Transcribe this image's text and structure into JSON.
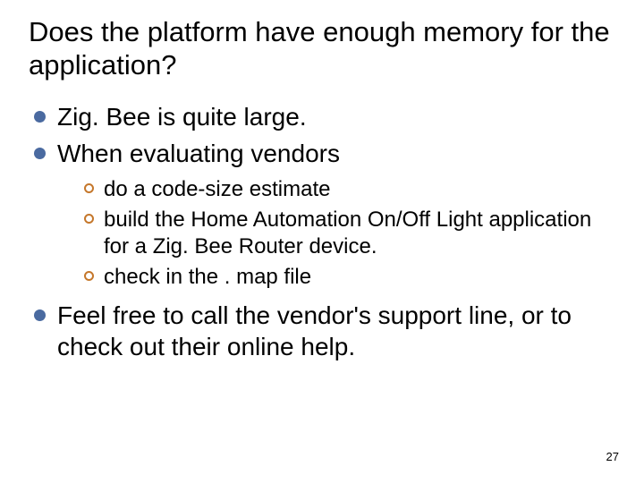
{
  "title": "Does the platform have enough memory for the application?",
  "bullets": {
    "b1": "Zig. Bee is quite large.",
    "b2": "When evaluating vendors",
    "b3": "Feel free to call the vendor's support line, or to check out their online help."
  },
  "sub": {
    "s1": "do a code-size estimate",
    "s2": "build the Home Automation On/Off Light application for a Zig. Bee Router device.",
    "s3": "check in the . map file"
  },
  "page_number": "27"
}
